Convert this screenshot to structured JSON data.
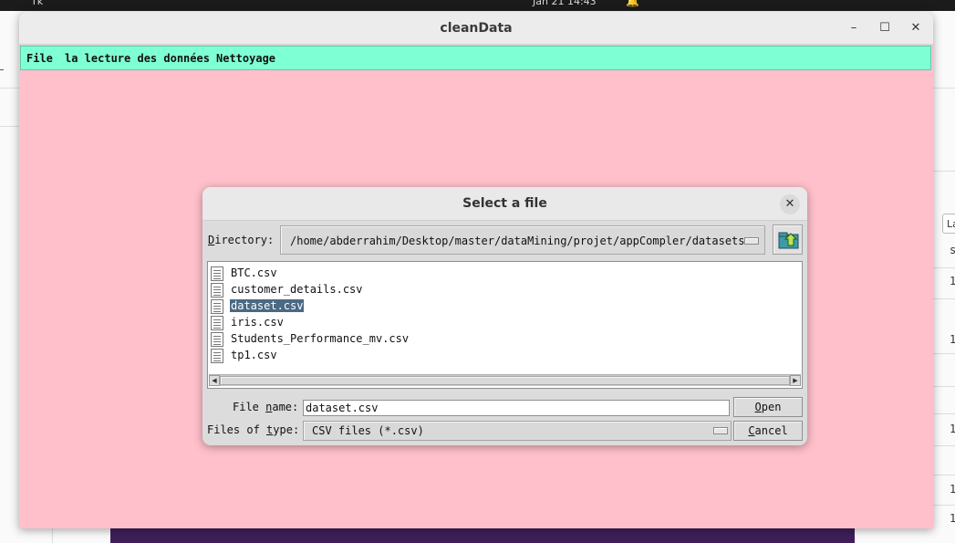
{
  "desktop": {
    "tray_label": "Tk",
    "clock": "Jan 21  14:43"
  },
  "background_app": {
    "tab_label": "La",
    "column_header": "s",
    "row_values": [
      "1",
      "1",
      "1",
      "1",
      "1"
    ]
  },
  "window": {
    "title": "cleanData",
    "controls": {
      "minimize": "–",
      "maximize": "☐",
      "close": "✕"
    },
    "menu": [
      "File",
      "la lecture des données",
      "Nettoyage"
    ],
    "background_color": "#ffc0cb",
    "menubar_color": "#7fffd4"
  },
  "dialog": {
    "title": "Select a file",
    "close_glyph": "✕",
    "directory_label_mnemonic": "D",
    "directory_label_rest": "irectory:",
    "directory_value": "/home/abderrahim/Desktop/master/dataMining/projet/appCompler/datasets",
    "files": [
      {
        "name": "BTC.csv",
        "selected": false
      },
      {
        "name": "customer_details.csv",
        "selected": false
      },
      {
        "name": "dataset.csv",
        "selected": true
      },
      {
        "name": "iris.csv",
        "selected": false
      },
      {
        "name": "Students_Performance_mv.csv",
        "selected": false
      },
      {
        "name": "tp1.csv",
        "selected": false
      }
    ],
    "scroll_left": "◀",
    "scroll_right": "▶",
    "file_name_label_pre": "File ",
    "file_name_label_mnemonic": "n",
    "file_name_label_post": "ame:",
    "file_name_value": "dataset.csv",
    "files_of_type_label_pre": "Files of ",
    "files_of_type_label_mnemonic": "t",
    "files_of_type_label_post": "ype:",
    "files_of_type_value": "CSV files (*.csv)",
    "open_mnemonic": "O",
    "open_rest": "pen",
    "cancel_mnemonic": "C",
    "cancel_rest": "ancel",
    "selection_color": "#4a6984"
  }
}
